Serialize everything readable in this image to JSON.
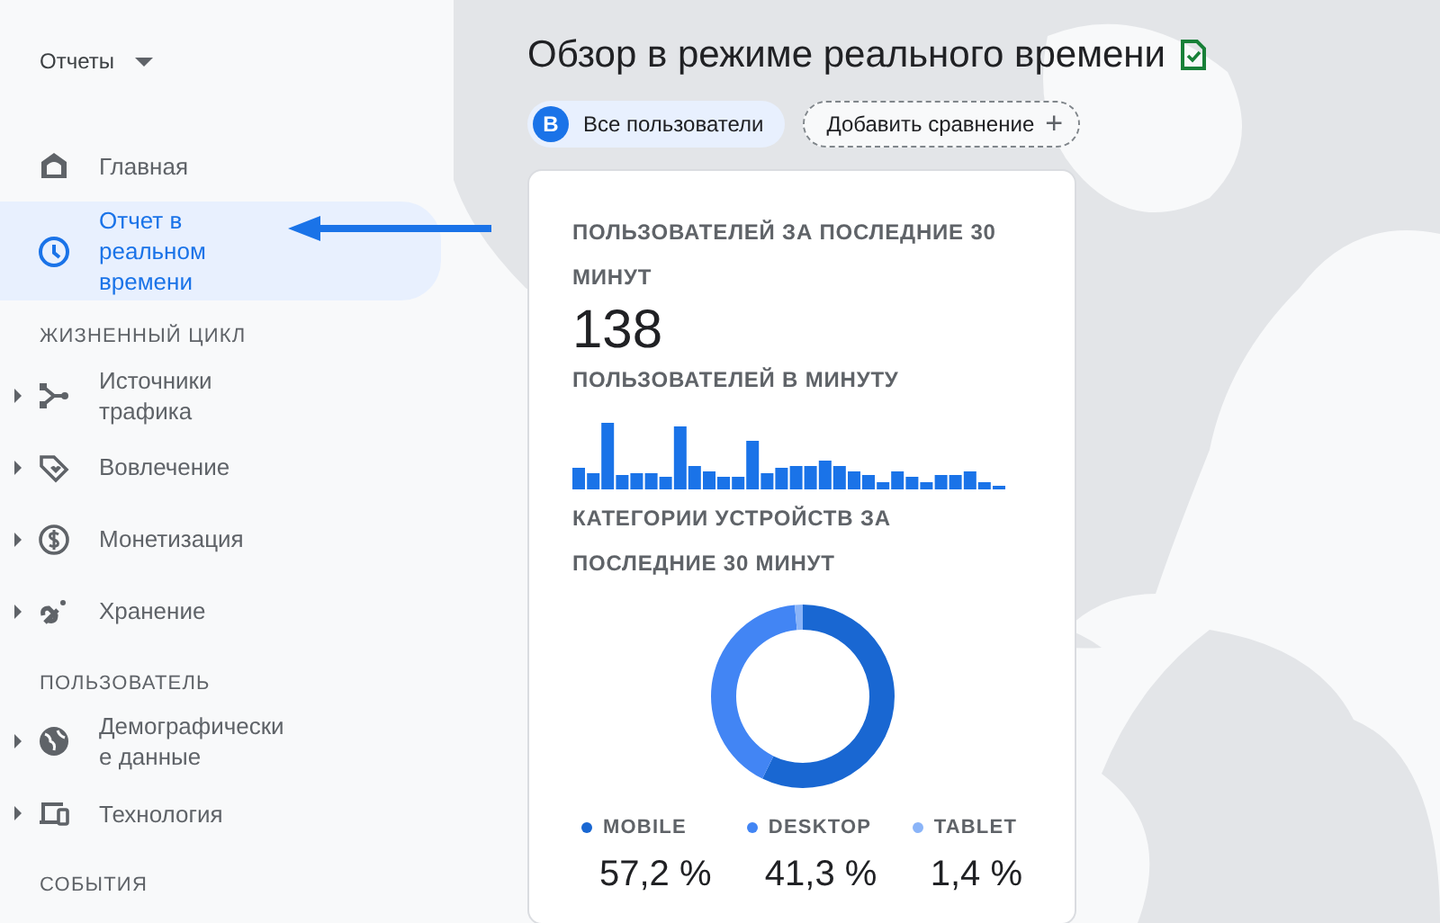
{
  "sidebar": {
    "header": {
      "label": "Отчеты"
    },
    "items": [
      {
        "kind": "item",
        "label": "Главная",
        "expandable": false,
        "selected": false
      },
      {
        "kind": "item",
        "label": "Отчет в реальном времени",
        "expandable": false,
        "selected": true
      },
      {
        "kind": "section",
        "label": "ЖИЗНЕННЫЙ ЦИКЛ"
      },
      {
        "kind": "item",
        "label": "Источники трафика",
        "expandable": true,
        "selected": false
      },
      {
        "kind": "item",
        "label": "Вовлечение",
        "expandable": true,
        "selected": false
      },
      {
        "kind": "item",
        "label": "Монетизация",
        "expandable": true,
        "selected": false
      },
      {
        "kind": "item",
        "label": "Хранение",
        "expandable": true,
        "selected": false
      },
      {
        "kind": "section",
        "label": "ПОЛЬЗОВАТЕЛЬ"
      },
      {
        "kind": "item",
        "label": "Демографические данные",
        "expandable": true,
        "selected": false
      },
      {
        "kind": "item",
        "label": "Технология",
        "expandable": true,
        "selected": false
      },
      {
        "kind": "section",
        "label": "СОБЫТИЯ"
      }
    ]
  },
  "page": {
    "title": "Обзор в режиме реального времени",
    "segment": {
      "avatar": "B",
      "label": "Все пользователи"
    },
    "compare_button": {
      "label": "Добавить сравнение",
      "icon": "+"
    }
  },
  "card": {
    "users_label": "ПОЛЬЗОВАТЕЛЕЙ ЗА ПОСЛЕДНИЕ 30 МИНУТ",
    "users_value": "138",
    "per_minute_label": "ПОЛЬЗОВАТЕЛЕЙ В МИНУТУ",
    "devices": {
      "label": "КАТЕГОРИИ УСТРОЙСТВ ЗА ПОСЛЕДНИЕ 30 МИНУТ",
      "legend": [
        {
          "value": "57,2 %",
          "color": "#1967d2"
        },
        {
          "value": "41,3 %",
          "color": "#4285f4"
        },
        {
          "value": "1,4 %",
          "color": "#8ab4f8"
        }
      ],
      "chart_data": {
        "type": "donut",
        "categories": [
          "MOBILE",
          "DESKTOP",
          "TABLET"
        ],
        "values": [
          57.2,
          41.3,
          1.4
        ]
      }
    }
  }
}
